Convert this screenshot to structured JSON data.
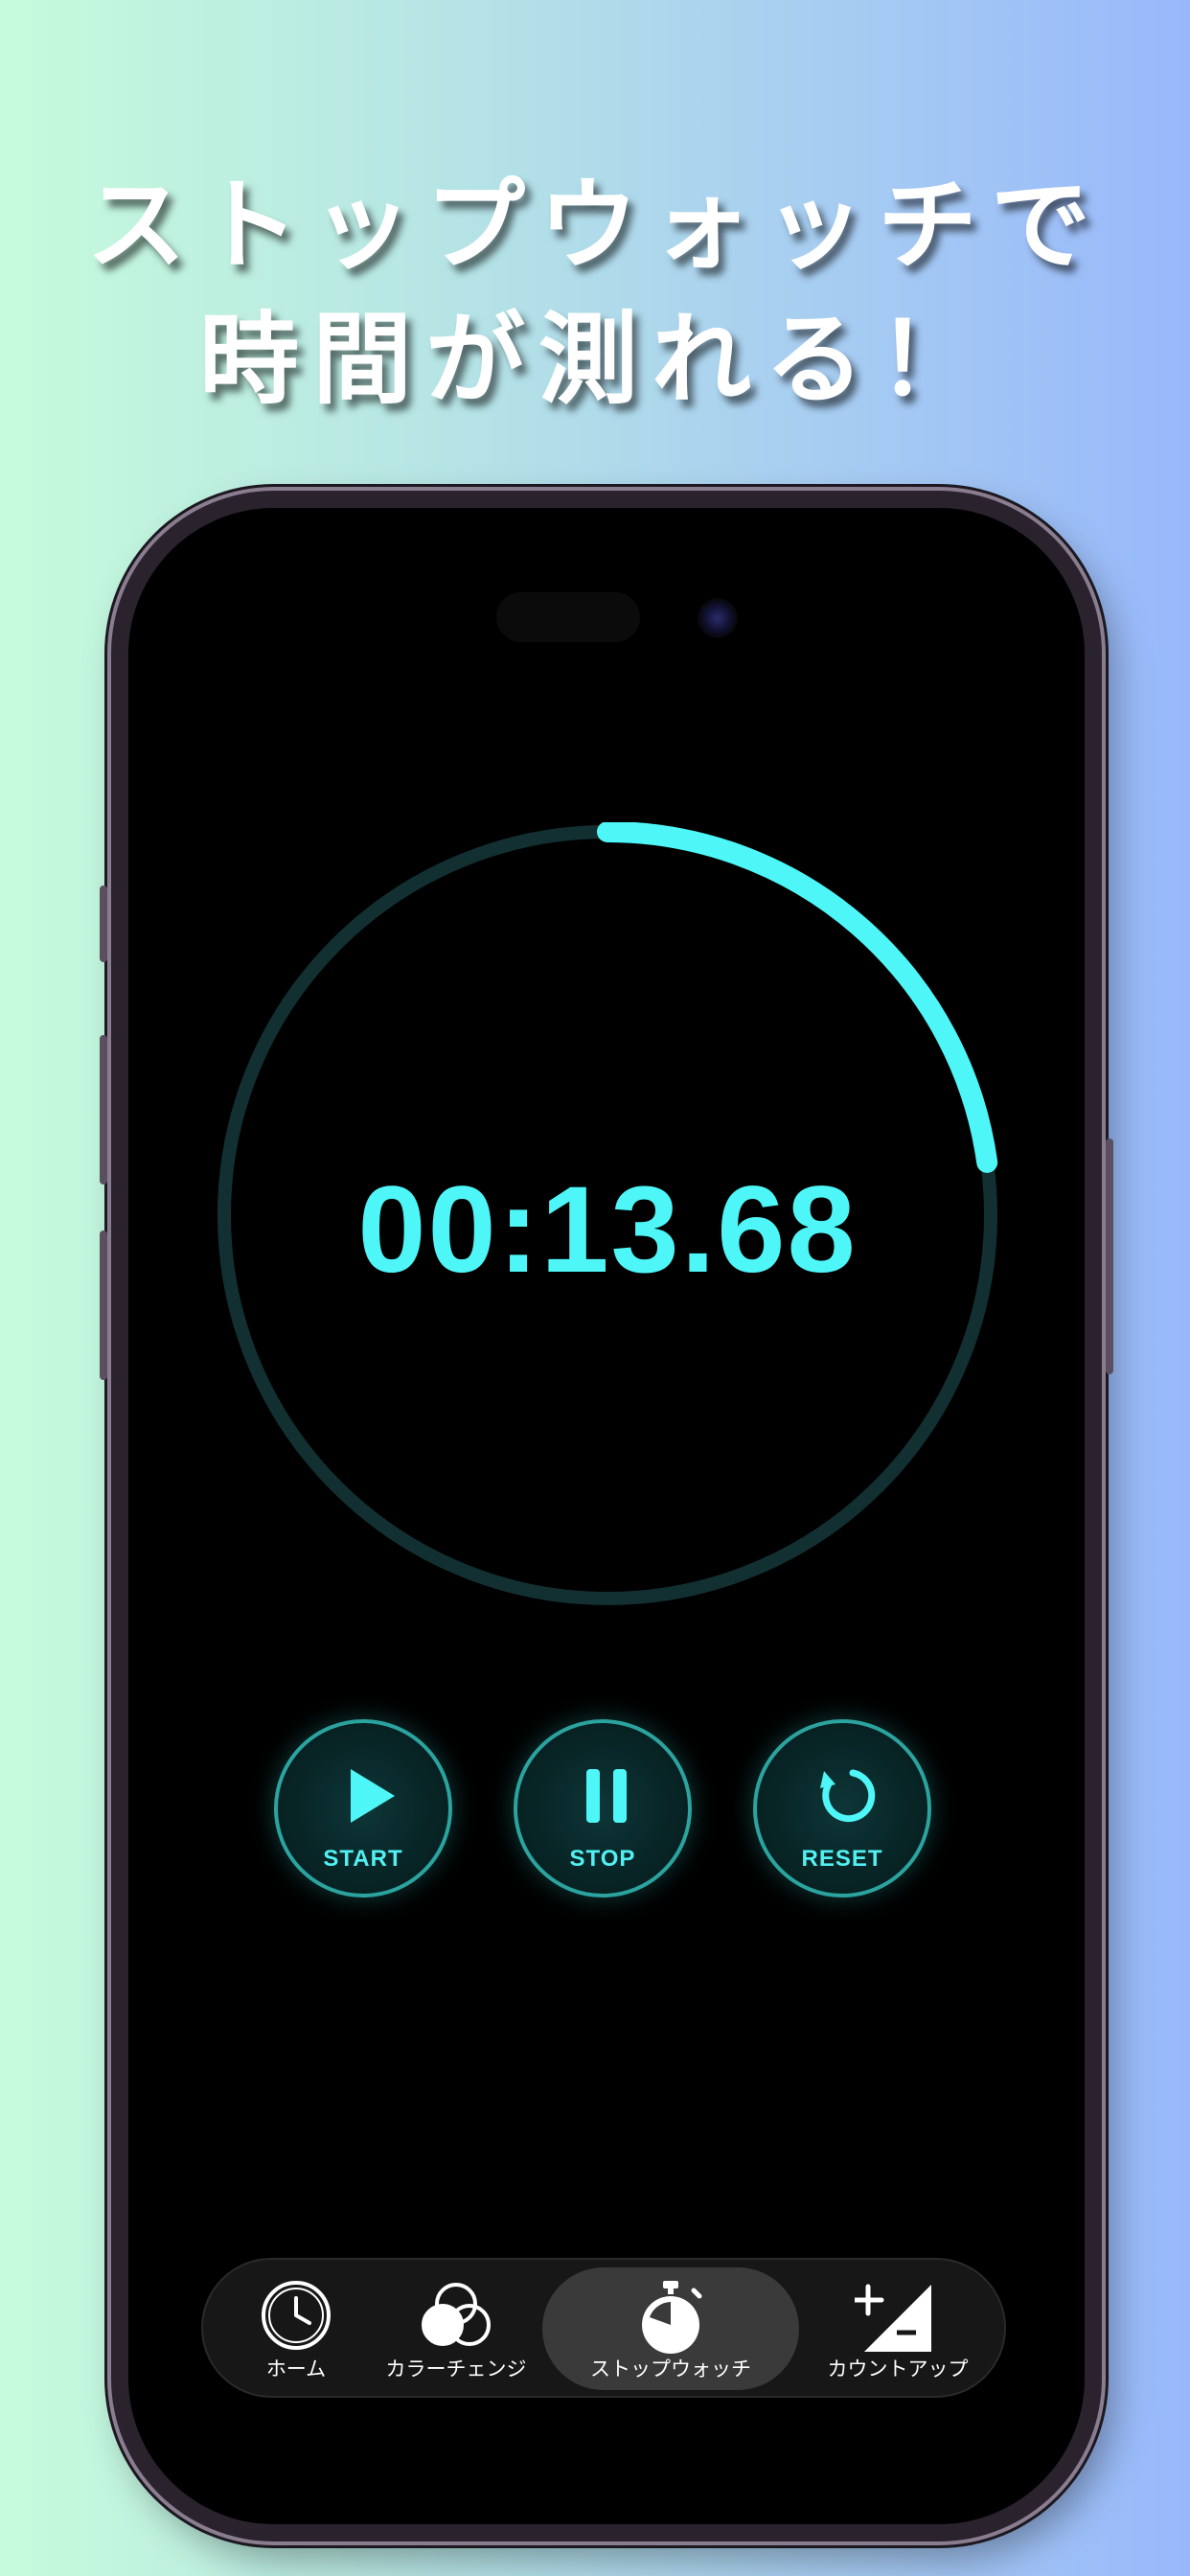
{
  "headline": {
    "line1": "ストップウォッチで",
    "line2": "時間が測れる！"
  },
  "stopwatch": {
    "time": "00:13.68",
    "progress_fraction": 0.228,
    "accent_color": "#4ef6f8",
    "track_color": "#123032"
  },
  "controls": [
    {
      "label": "START",
      "icon": "play-icon"
    },
    {
      "label": "STOP",
      "icon": "pause-icon"
    },
    {
      "label": "RESET",
      "icon": "reset-icon"
    }
  ],
  "tabs": [
    {
      "label": "ホーム",
      "icon": "clock-icon",
      "active": false
    },
    {
      "label": "カラーチェンジ",
      "icon": "color-circles-icon",
      "active": false
    },
    {
      "label": "ストップウォッチ",
      "icon": "stopwatch-icon",
      "active": true
    },
    {
      "label": "カウントアップ",
      "icon": "plus-triangle-icon",
      "active": false
    }
  ]
}
